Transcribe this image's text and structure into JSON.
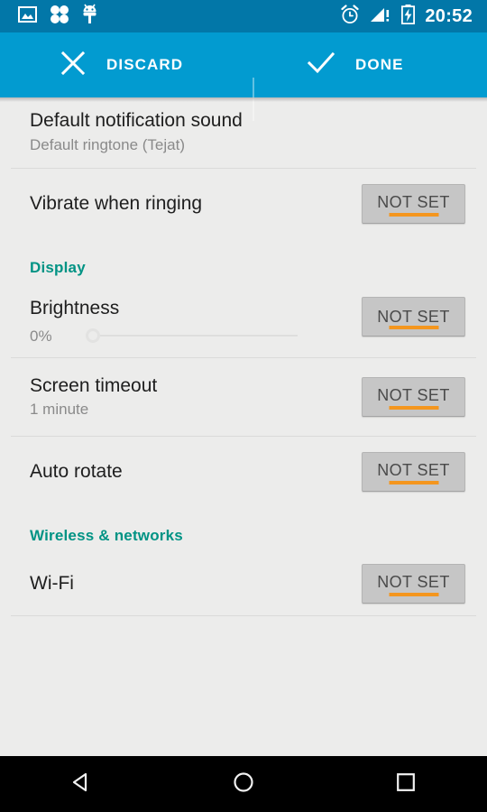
{
  "statusbar": {
    "time": "20:52",
    "left_icons": [
      "image-icon",
      "apps-grid-icon",
      "android-usb-icon"
    ],
    "right_icons": [
      "alarm-icon",
      "signal-no-service-icon",
      "battery-charging-icon"
    ]
  },
  "actionbar": {
    "discard_label": "DISCARD",
    "done_label": "DONE",
    "background": "#029bd0"
  },
  "theme": {
    "accent_teal": "#009384",
    "orange_underline": "#f4961e",
    "button_gray": "#c6c6c6"
  },
  "rows": {
    "notification_sound": {
      "title": "Default notification sound",
      "subtitle": "Default ringtone (Tejat)"
    },
    "vibrate": {
      "title": "Vibrate when ringing",
      "action": "NOT SET"
    },
    "brightness": {
      "title": "Brightness",
      "percent": "0%",
      "slider_value": 0,
      "action": "NOT SET"
    },
    "screen_timeout": {
      "title": "Screen timeout",
      "subtitle": "1 minute",
      "action": "NOT SET"
    },
    "auto_rotate": {
      "title": "Auto rotate",
      "action": "NOT SET"
    },
    "wifi": {
      "title": "Wi-Fi",
      "action": "NOT SET"
    }
  },
  "sections": {
    "display": "Display",
    "wireless": "Wireless & networks"
  },
  "navbar": {
    "back": "back-icon",
    "home": "home-icon",
    "recents": "recents-icon"
  }
}
